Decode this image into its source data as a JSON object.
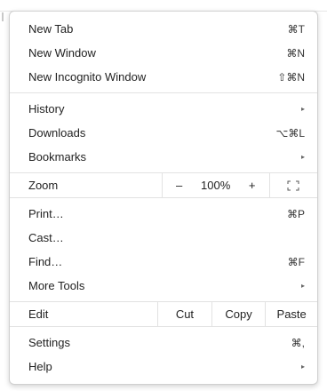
{
  "menu": {
    "group1": [
      {
        "label": "New Tab",
        "shortcut": "⌘T"
      },
      {
        "label": "New Window",
        "shortcut": "⌘N"
      },
      {
        "label": "New Incognito Window",
        "shortcut": "⇧⌘N"
      }
    ],
    "group2": [
      {
        "label": "History",
        "shortcut": "▸"
      },
      {
        "label": "Downloads",
        "shortcut": "⌥⌘L"
      },
      {
        "label": "Bookmarks",
        "shortcut": "▸"
      }
    ],
    "zoom": {
      "label": "Zoom",
      "minus": "–",
      "value": "100%",
      "plus": "+",
      "fullscreen_icon": "fullscreen-icon"
    },
    "group3": [
      {
        "label": "Print…",
        "shortcut": "⌘P"
      },
      {
        "label": "Cast…",
        "shortcut": ""
      },
      {
        "label": "Find…",
        "shortcut": "⌘F"
      },
      {
        "label": "More Tools",
        "shortcut": "▸"
      }
    ],
    "edit": {
      "label": "Edit",
      "cut": "Cut",
      "copy": "Copy",
      "paste": "Paste"
    },
    "group4": [
      {
        "label": "Settings",
        "shortcut": "⌘,"
      },
      {
        "label": "Help",
        "shortcut": "▸"
      }
    ]
  }
}
